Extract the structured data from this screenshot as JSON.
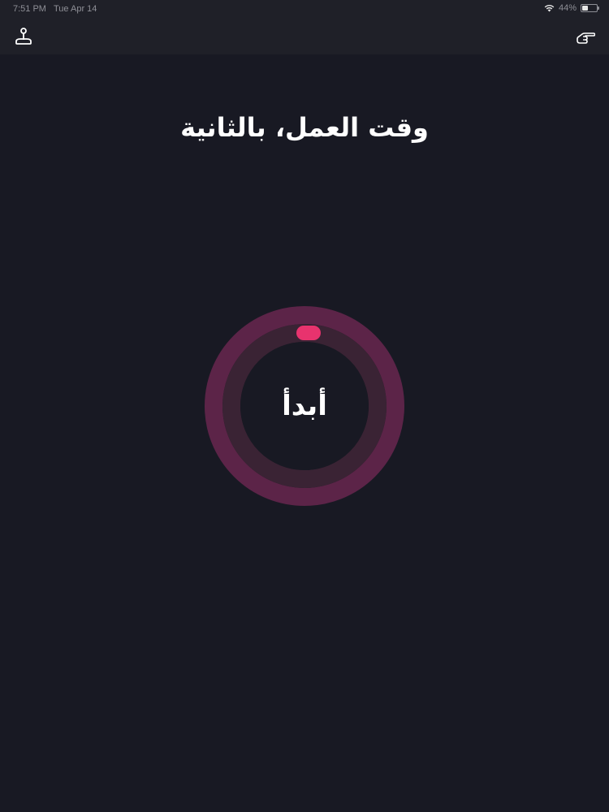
{
  "status_bar": {
    "time": "7:51 PM",
    "date": "Tue Apr 14",
    "battery": "44%",
    "battery_level": 0.44
  },
  "nav": {
    "left_icon": "joystick-icon",
    "right_icon": "pointing-hand-icon"
  },
  "title": "وقت العمل، بالثانية",
  "ring": {
    "label": "أبدأ",
    "progress": 0,
    "colors": {
      "outer_ring": "#5c2448",
      "inner_ring": "#3a2334",
      "indicator": "#e8336e",
      "background": "#181923"
    }
  }
}
